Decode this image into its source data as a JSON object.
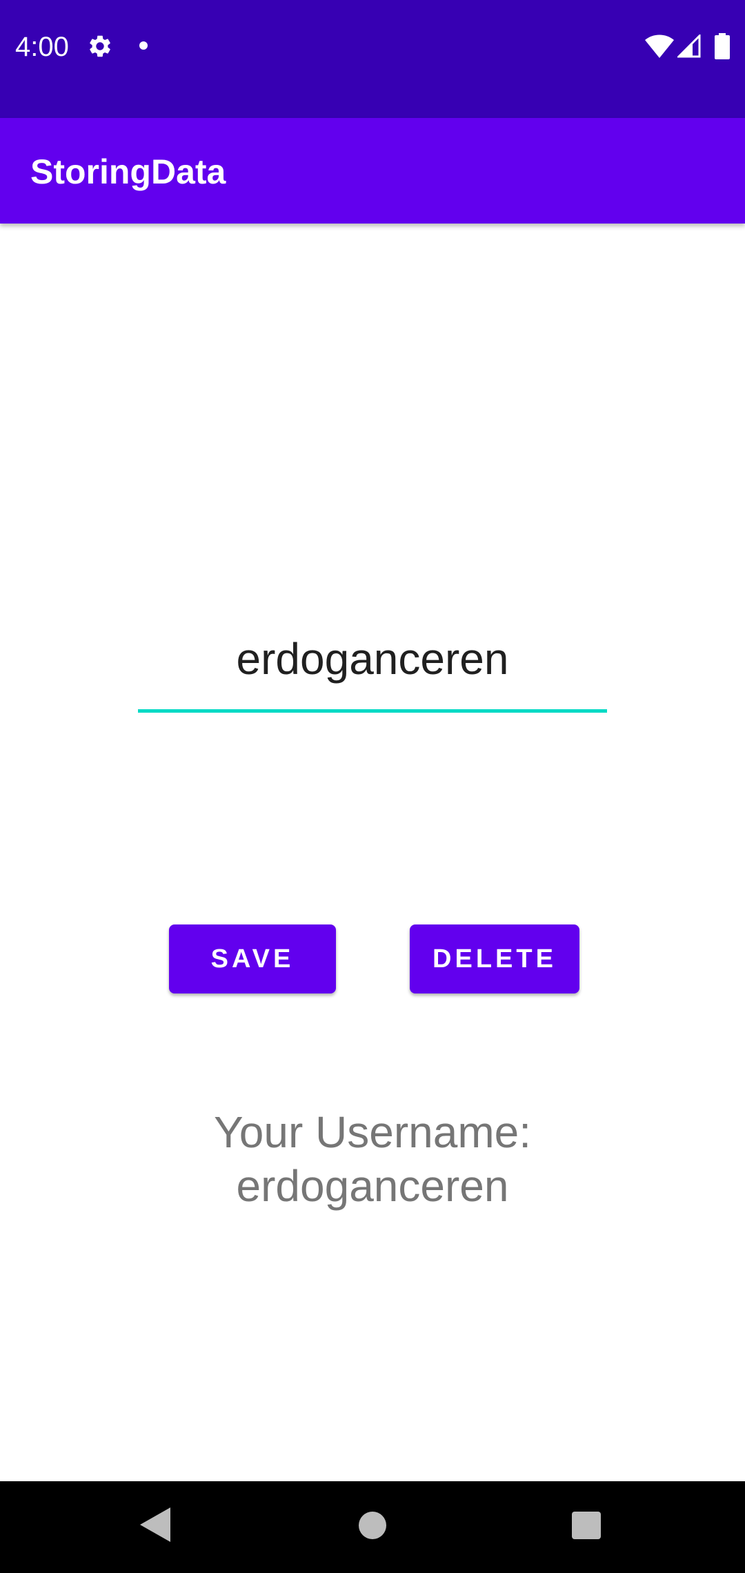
{
  "status_bar": {
    "time": "4:00",
    "icons": [
      "gear-icon",
      "notification-dot-icon",
      "wifi-icon",
      "signal-icon",
      "battery-icon"
    ],
    "color": "#3700b3"
  },
  "app_bar": {
    "title": "StoringData",
    "color": "#6200ee"
  },
  "form": {
    "username_value": "erdoganceren",
    "accent_color": "#03dac5"
  },
  "buttons": {
    "save_label": "SAVE",
    "delete_label": "DELETE",
    "color": "#6200ee"
  },
  "result": {
    "label": "Your Username:",
    "value": "erdoganceren"
  },
  "nav_bar": {
    "icons": [
      "back-icon",
      "home-icon",
      "recents-icon"
    ]
  }
}
